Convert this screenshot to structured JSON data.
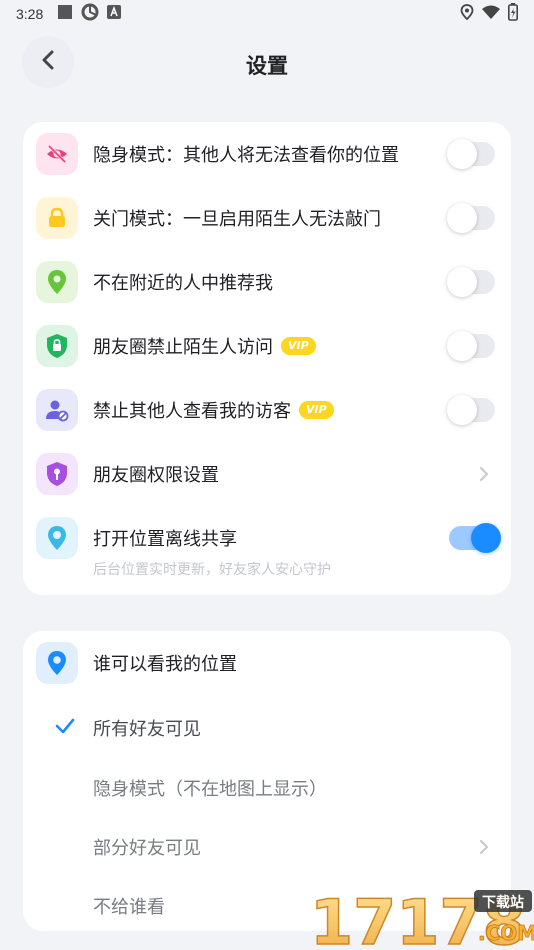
{
  "status_bar": {
    "time": "3:28"
  },
  "header": {
    "title": "设置"
  },
  "settings": [
    {
      "label": "隐身模式：其他人将无法查看你的位置",
      "icon": "eye-off-icon",
      "icon_bg": "#fde4ee",
      "icon_color": "#ee3f7a",
      "control": "toggle",
      "on": false,
      "vip": false
    },
    {
      "label": "关门模式：一旦启用陌生人无法敲门",
      "icon": "lock-icon",
      "icon_bg": "#fff5d6",
      "icon_color": "#ffc81c",
      "control": "toggle",
      "on": false,
      "vip": false
    },
    {
      "label": "不在附近的人中推荐我",
      "icon": "location-pin-icon",
      "icon_bg": "#e6f6dd",
      "icon_color": "#67c53a",
      "control": "toggle",
      "on": false,
      "vip": false
    },
    {
      "label": "朋友圈禁止陌生人访问",
      "icon": "shield-lock-icon",
      "icon_bg": "#def5e6",
      "icon_color": "#22b560",
      "control": "toggle",
      "on": false,
      "vip": true
    },
    {
      "label": "禁止其他人查看我的访客",
      "icon": "user-block-icon",
      "icon_bg": "#e8e8fb",
      "icon_color": "#6a62e0",
      "control": "toggle",
      "on": false,
      "vip": true
    },
    {
      "label": "朋友圈权限设置",
      "icon": "shield-key-icon",
      "icon_bg": "#f3e5fb",
      "icon_color": "#a64fe0",
      "control": "chevron",
      "vip": false
    },
    {
      "label": "打开位置离线共享",
      "icon": "location-pin-outline-icon",
      "icon_bg": "#e2f4fb",
      "icon_color": "#3cb8e6",
      "control": "toggle",
      "on": true,
      "vip": false
    }
  ],
  "vip_label": "VIP",
  "offline_share_hint": "后台位置实时更新，好友家人安心守护",
  "visibility": {
    "title": "谁可以看我的位置",
    "icon_bg": "#e1effd",
    "icon_color": "#1a8cff",
    "options": [
      {
        "label": "所有好友可见",
        "selected": true,
        "chevron": false
      },
      {
        "label": "隐身模式（不在地图上显示）",
        "selected": false,
        "chevron": false
      },
      {
        "label": "部分好友可见",
        "selected": false,
        "chevron": true
      },
      {
        "label": "不给谁看",
        "selected": false,
        "chevron": false
      }
    ]
  },
  "watermark": {
    "text": "17178",
    "sub": "下载站",
    "domain": ".COM"
  },
  "colors": {
    "accent": "#1a8cff",
    "vip": "#ffd51f",
    "background": "#f2f3f7"
  }
}
